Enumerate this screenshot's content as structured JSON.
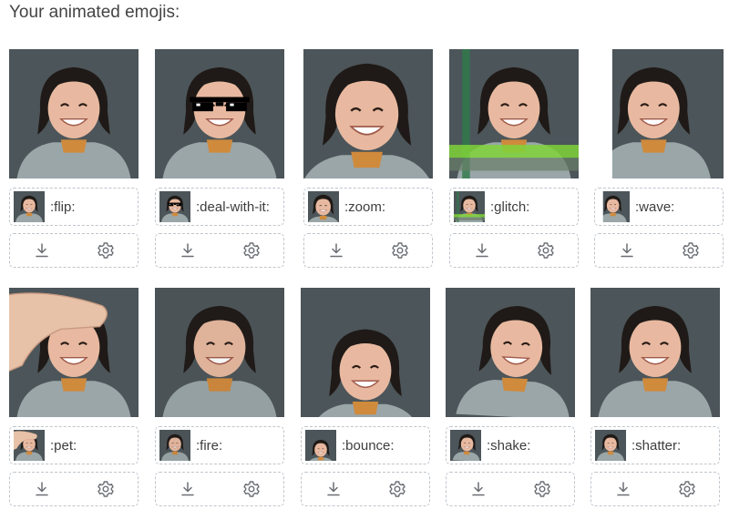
{
  "heading": "Your animated emojis:",
  "emojis": [
    {
      "name": ":flip:",
      "effect": "flip"
    },
    {
      "name": ":deal-with-it:",
      "effect": "deal-with-it"
    },
    {
      "name": ":zoom:",
      "effect": "zoom"
    },
    {
      "name": ":glitch:",
      "effect": "glitch"
    },
    {
      "name": ":wave:",
      "effect": "wave"
    },
    {
      "name": ":pet:",
      "effect": "pet"
    },
    {
      "name": ":fire:",
      "effect": "fire"
    },
    {
      "name": ":bounce:",
      "effect": "bounce"
    },
    {
      "name": ":shake:",
      "effect": "shake"
    },
    {
      "name": ":shatter:",
      "effect": "shatter"
    }
  ],
  "icons": {
    "download": "download-icon",
    "settings": "gear-icon"
  },
  "colors": {
    "background": "#4c5559",
    "border": "#bfc5cc",
    "sweater": "#9aa6a8",
    "hair": "#1f1a17"
  }
}
